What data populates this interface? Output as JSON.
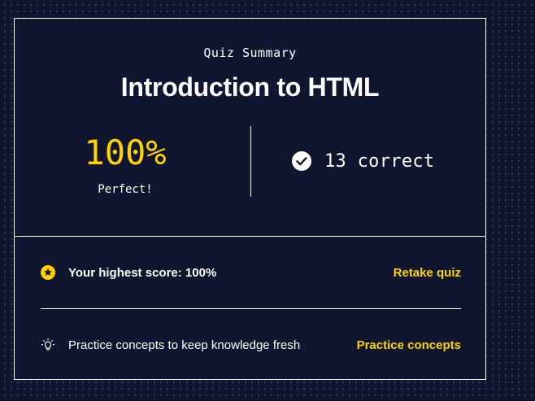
{
  "colors": {
    "background": "#10162f",
    "accent": "#ffd300",
    "text": "#ffffff"
  },
  "summary": {
    "eyebrow": "Quiz Summary",
    "title": "Introduction to HTML",
    "score": "100%",
    "score_note": "Perfect!",
    "correct_text": "13 correct",
    "correct_icon": "check-circle-icon"
  },
  "actions": {
    "highest": {
      "icon": "star-badge-icon",
      "label": "Your highest score: 100%",
      "link": "Retake quiz"
    },
    "practice": {
      "icon": "lightbulb-icon",
      "label": "Practice concepts to keep knowledge fresh",
      "link": "Practice concepts"
    }
  }
}
